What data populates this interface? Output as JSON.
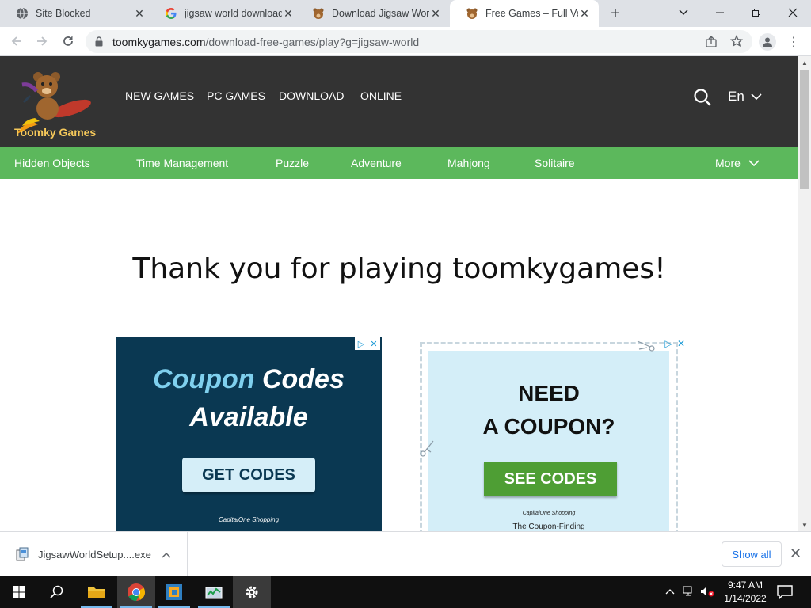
{
  "tabs": [
    {
      "title": "Site Blocked",
      "favicon": "globe-icon"
    },
    {
      "title": "jigsaw world download",
      "favicon": "google-icon"
    },
    {
      "title": "Download Jigsaw World",
      "favicon": "bear-icon"
    },
    {
      "title": "Free Games – Full Version",
      "favicon": "bear-icon",
      "active": true
    }
  ],
  "toolbar": {
    "url_host": "toomkygames.com",
    "url_path": "/download-free-games/play?g=jigsaw-world"
  },
  "site": {
    "logo_text": "Toomky Games",
    "top_nav": [
      "NEW GAMES",
      "PC GAMES",
      "DOWNLOAD",
      "ONLINE"
    ],
    "lang": "En",
    "categories": [
      "Hidden Objects",
      "Time Management",
      "Puzzle",
      "Adventure",
      "Mahjong",
      "Solitaire"
    ],
    "more_label": "More",
    "headline": "Thank you for playing toomkygames!"
  },
  "ad1": {
    "line1a": "Coupon",
    "line1b": "Codes",
    "line2": "Available",
    "button": "GET CODES",
    "brand": "CapitalOne Shopping"
  },
  "ad2": {
    "line1": "NEED",
    "line2": "A COUPON?",
    "button": "SEE CODES",
    "brand": "CapitalOne Shopping",
    "sub": "The Coupon-Finding"
  },
  "download": {
    "filename": "JigsawWorldSetup....exe",
    "show_all": "Show all"
  },
  "taskbar": {
    "time": "9:47 AM",
    "date": "1/14/2022"
  },
  "colors": {
    "header_bg": "#333333",
    "category_bg": "#5cb85c",
    "ad1_bg": "#0a3852",
    "ad2_bg": "#d4eef8",
    "ad2_button": "#4e9e34"
  }
}
